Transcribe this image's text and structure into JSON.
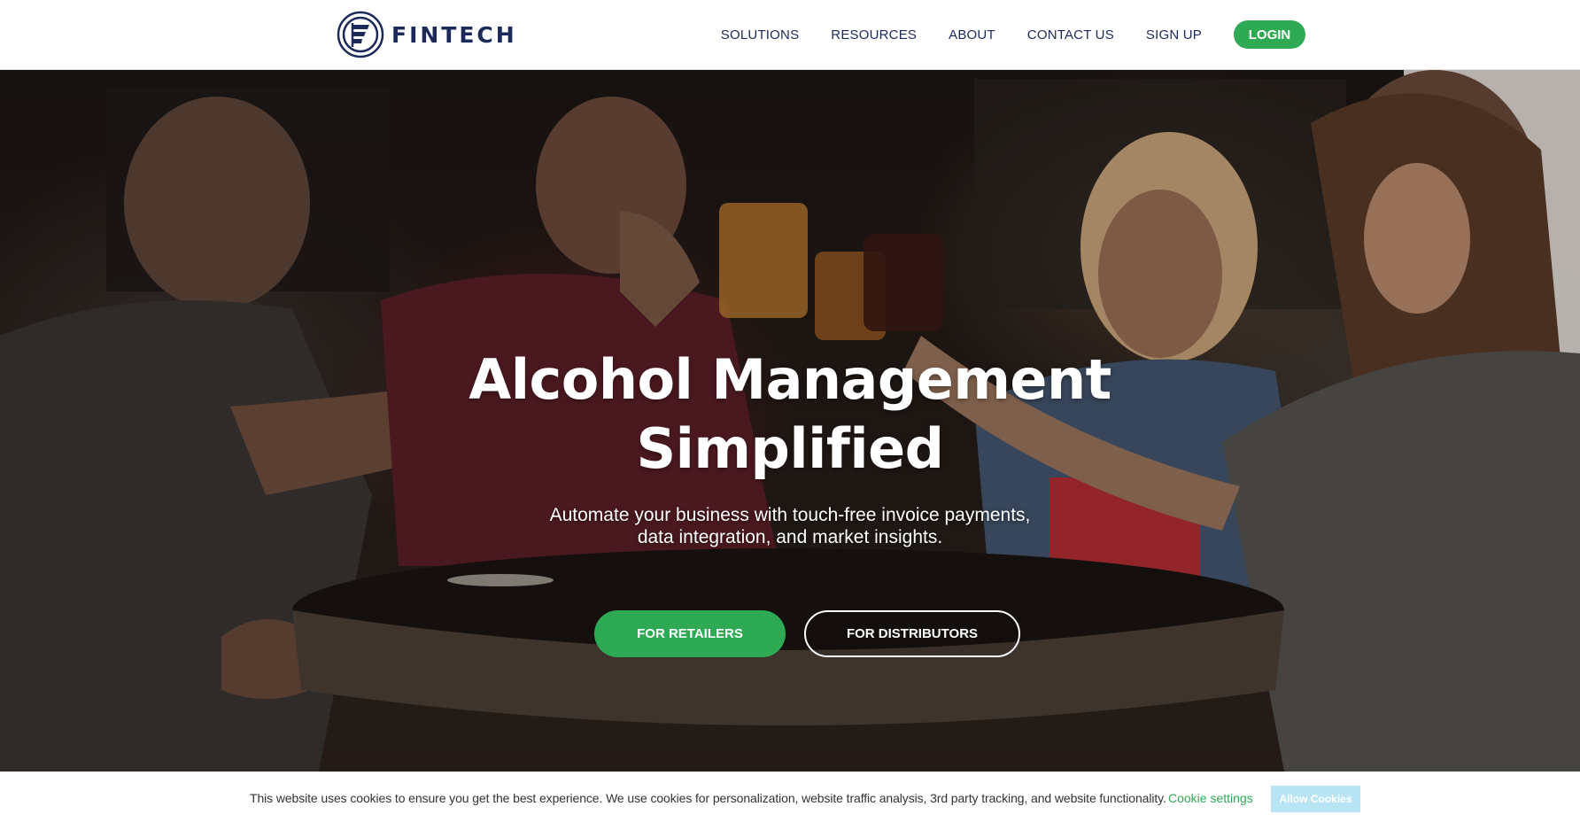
{
  "header": {
    "brand": "FINTECH",
    "nav": [
      "SOLUTIONS",
      "RESOURCES",
      "ABOUT",
      "CONTACT US",
      "SIGN UP"
    ],
    "login_label": "LOGIN"
  },
  "hero": {
    "title_line1": "Alcohol Management",
    "title_line2": "Simplified",
    "subtitle_line1": "Automate your business with touch-free invoice payments,",
    "subtitle_line2": "data integration, and market insights.",
    "cta_primary": "FOR RETAILERS",
    "cta_secondary": "FOR DISTRIBUTORS"
  },
  "cookie_bar": {
    "message": "This website uses cookies to ensure you get the best experience. We use cookies for personalization, website traffic analysis, 3rd party tracking, and website functionality.",
    "settings_label": "Cookie settings",
    "allow_label": "Allow Cookies"
  },
  "colors": {
    "brand_navy": "#1b2a58",
    "accent_green": "#2eaa55",
    "allow_button": "#b9e4f3"
  }
}
